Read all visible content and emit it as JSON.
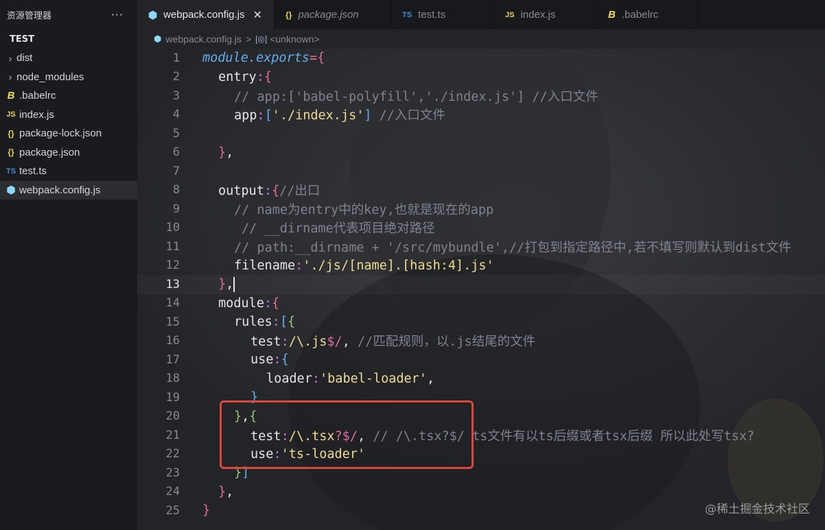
{
  "sidebar": {
    "title": "资源管理器",
    "more": "···",
    "section": "TEST",
    "items": [
      {
        "label": "dist",
        "icon": "chevron-right-icon",
        "glyph": "›"
      },
      {
        "label": "node_modules",
        "icon": "chevron-right-icon",
        "glyph": "›"
      },
      {
        "label": ".babelrc",
        "icon": "babel-icon",
        "glyph": "B"
      },
      {
        "label": "index.js",
        "icon": "js-file-icon",
        "glyph": "JS"
      },
      {
        "label": "package-lock.json",
        "icon": "json-file-icon",
        "glyph": "{}"
      },
      {
        "label": "package.json",
        "icon": "json-file-icon",
        "glyph": "{}"
      },
      {
        "label": "test.ts",
        "icon": "ts-file-icon",
        "glyph": "TS"
      },
      {
        "label": "webpack.config.js",
        "icon": "webpack-icon",
        "glyph": "⬢"
      }
    ]
  },
  "tabs": [
    {
      "label": "webpack.config.js",
      "glyph": "⬢",
      "close": "✕"
    },
    {
      "label": "package.json",
      "glyph": "{}"
    },
    {
      "label": "test.ts",
      "glyph": "TS"
    },
    {
      "label": "index.js",
      "glyph": "JS"
    },
    {
      "label": ".babelrc",
      "glyph": "B"
    }
  ],
  "breadcrumb": {
    "file": "webpack.config.js",
    "separator": ">",
    "symbol": "<unknown>"
  },
  "line_numbers": [
    "1",
    "2",
    "3",
    "4",
    "5",
    "6",
    "7",
    "8",
    "9",
    "10",
    "11",
    "12",
    "13",
    "14",
    "15",
    "16",
    "17",
    "18",
    "19",
    "20",
    "21",
    "22",
    "23",
    "24",
    "25"
  ],
  "current_line": "13",
  "code": {
    "l1": {
      "a": "module.exports",
      "b": "=",
      "c": "{"
    },
    "l2": {
      "a": "entry",
      "b": ":",
      "c": "{"
    },
    "l3": "// app:['babel-polyfill','./index.js'] //入口文件",
    "l4": {
      "a": "app",
      "b": ":",
      "c": "[",
      "d": "'./index.js'",
      "e": "]",
      "f": " //入口文件"
    },
    "l6": {
      "a": "}",
      "b": ","
    },
    "l8": {
      "a": "output",
      "b": ":",
      "c": "{",
      "d": "//出口"
    },
    "l9": "// name为entry中的key,也就是现在的app",
    "l10": "// __dirname代表项目绝对路径",
    "l11": "// path:__dirname + '/src/mybundle',//打包到指定路径中,若不填写则默认到dist文件",
    "l12": {
      "a": "filename",
      "b": ":",
      "c": "'./js/[name].[hash:4].js'"
    },
    "l13": {
      "a": "}",
      "b": ","
    },
    "l14": {
      "a": "module",
      "b": ":",
      "c": "{"
    },
    "l15": {
      "a": "rules",
      "b": ":",
      "c": "[",
      "d": "{"
    },
    "l16": {
      "a": "test",
      "b": ":",
      "c": "/\\.js",
      "d": "$/",
      "e": ",",
      "f": " //匹配规则，以.js结尾的文件"
    },
    "l17": {
      "a": "use",
      "b": ":",
      "c": "{"
    },
    "l18": {
      "a": "loader",
      "b": ":",
      "c": "'babel-loader'",
      "d": ","
    },
    "l19": {
      "a": "}"
    },
    "l20": {
      "a": "}",
      "b": ",",
      "c": "{"
    },
    "l21": {
      "a": "test",
      "b": ":",
      "c": "/\\.tsx",
      "d": "?$/",
      "e": ",",
      "f": " // /\\.tsx?$/ ts文件有以ts后缀或者tsx后缀 所以此处写tsx?"
    },
    "l22": {
      "a": "use",
      "b": ":",
      "c": "'ts-loader'"
    },
    "l23": {
      "a": "}",
      "b": "]"
    },
    "l24": {
      "a": "}",
      "b": ","
    },
    "l25": {
      "a": "}"
    }
  },
  "watermark": "@稀土掘金技术社区",
  "colors": {
    "highlight_box": "#e0453a",
    "string": "#f0dc8c",
    "comment": "#7f8390",
    "bracket": "#e06c9f"
  }
}
